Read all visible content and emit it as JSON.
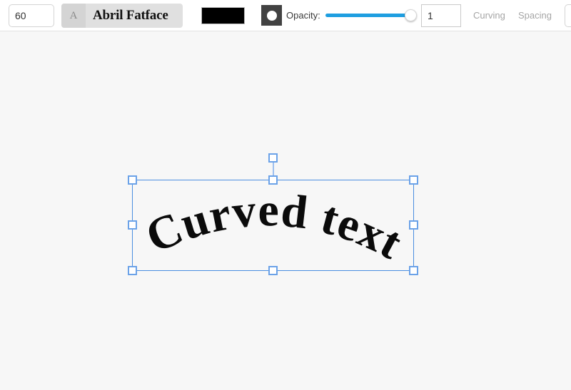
{
  "toolbar": {
    "font_size": {
      "value": "60",
      "placeholder": "Size"
    },
    "font_picker": {
      "icon": "letter-a-icon",
      "icon_glyph": "A",
      "font_name": "Abril Fatface"
    },
    "color_swatch": {
      "name": "text-color-swatch",
      "color": "#000000"
    },
    "opacity_icon": {
      "name": "opacity-icon"
    },
    "opacity_label": "Opacity:",
    "opacity_slider": {
      "value": 1,
      "min": 0,
      "max": 1,
      "track_color": "#1e9ee0"
    },
    "opacity_input": {
      "value": "1",
      "placeholder": "1"
    },
    "tabs": [
      {
        "label": "Curving"
      },
      {
        "label": "Spacing"
      }
    ]
  },
  "canvas": {
    "background": "#f7f7f7",
    "selection": {
      "accent_color": "#4a8ee0",
      "handle_count": 8,
      "has_rotation_handle": true
    },
    "text_object": {
      "content": "Curved text",
      "font_family": "Abril Fatface",
      "font_size": "60",
      "color": "#000000",
      "opacity": "1",
      "effect": "curved"
    }
  }
}
